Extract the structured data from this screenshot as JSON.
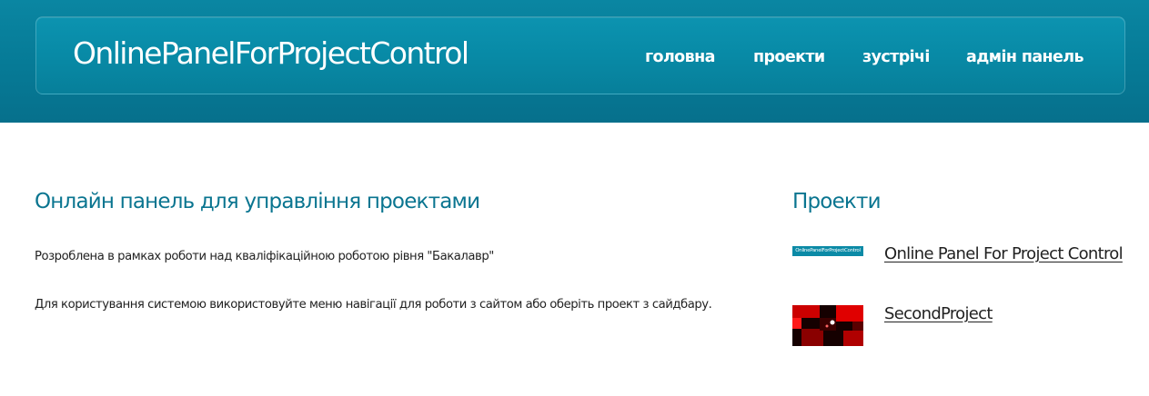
{
  "header": {
    "site_title": "OnlinePanelForProjectControl",
    "nav": [
      {
        "label": "головна"
      },
      {
        "label": "проекти"
      },
      {
        "label": "зустрічі"
      },
      {
        "label": "адмін панель"
      }
    ]
  },
  "main": {
    "heading": "Онлайн панель для управління проектами",
    "paragraph_1": "Розроблена в рамках роботи над кваліфікаційною роботою рівня \"Бакалавр\"",
    "paragraph_2": "Для користування системою використовуйте меню навігації для роботи з сайтом або оберіть проект з сайдбару."
  },
  "sidebar": {
    "heading": "Проекти",
    "projects": [
      {
        "title": "Online Panel For Project Control",
        "thumb_text": "OnlinePanelForProjectControl"
      },
      {
        "title": "SecondProject"
      }
    ]
  },
  "colors": {
    "header_bg": "#067a96",
    "accent_heading": "#0a7590",
    "text": "#222222"
  }
}
